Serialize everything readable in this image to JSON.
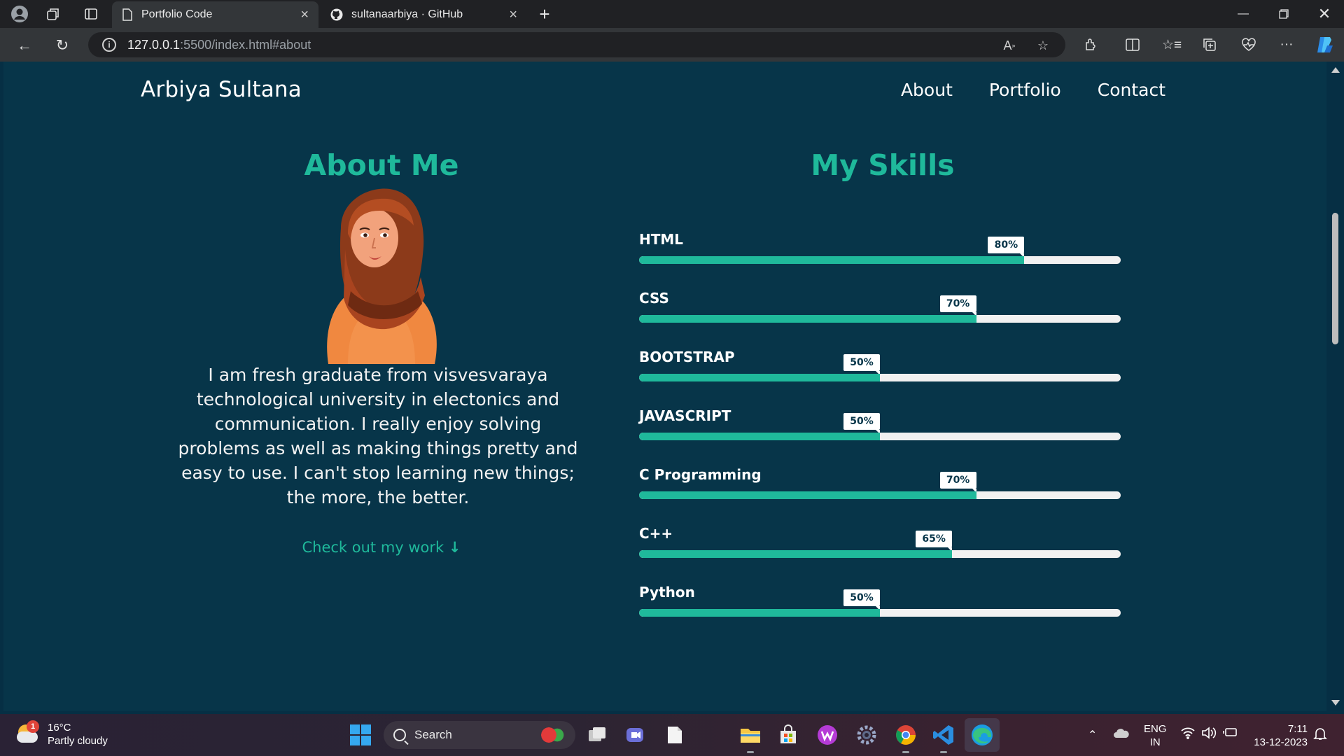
{
  "browser": {
    "tabs": [
      {
        "title": "Portfolio Code",
        "active": true
      },
      {
        "title": "sultanaarbiya · GitHub",
        "active": false
      }
    ],
    "url_host": "127.0.0.1",
    "url_rest": ":5500/index.html#about"
  },
  "site": {
    "name": "Arbiya Sultana",
    "nav": [
      "About",
      "Portfolio",
      "Contact"
    ]
  },
  "about": {
    "title": "About Me",
    "text": "I am fresh graduate from visvesvaraya technological university in electonics and communication. I really enjoy solving problems as well as making things pretty and easy to use. I can't stop learning new things; the more, the better.",
    "cta": "Check out my work",
    "cta_arrow": "↓"
  },
  "skills": {
    "title": "My Skills",
    "items": [
      {
        "name": "HTML",
        "percent": 80,
        "label": "80%"
      },
      {
        "name": "CSS",
        "percent": 70,
        "label": "70%"
      },
      {
        "name": "BOOTSTRAP",
        "percent": 50,
        "label": "50%"
      },
      {
        "name": "JAVASCRIPT",
        "percent": 50,
        "label": "50%"
      },
      {
        "name": "C Programming",
        "percent": 70,
        "label": "70%"
      },
      {
        "name": "C++",
        "percent": 65,
        "label": "65%"
      },
      {
        "name": "Python",
        "percent": 50,
        "label": "50%"
      }
    ]
  },
  "taskbar": {
    "weather_temp": "16°C",
    "weather_desc": "Partly cloudy",
    "weather_badge": "1",
    "search_label": "Search",
    "lang_top": "ENG",
    "lang_bottom": "IN",
    "time": "7:11",
    "date": "13-12-2023"
  },
  "colors": {
    "accent": "#1fb99b",
    "page_bg": "#073549"
  }
}
